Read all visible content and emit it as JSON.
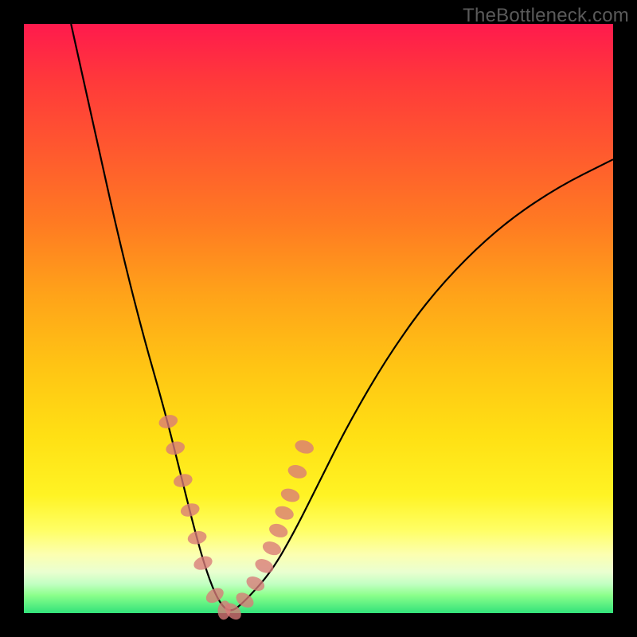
{
  "watermark": "TheBottleneck.com",
  "chart_data": {
    "type": "line",
    "title": "",
    "xlabel": "",
    "ylabel": "",
    "xlim": [
      0,
      100
    ],
    "ylim": [
      0,
      100
    ],
    "grid": false,
    "legend": false,
    "series": [
      {
        "name": "bottleneck-curve",
        "x": [
          8,
          12,
          16,
          20,
          24,
          27,
          29,
          31,
          33,
          35,
          37.5,
          42,
          46,
          50,
          55,
          62,
          70,
          80,
          90,
          100
        ],
        "y": [
          100,
          82,
          64,
          48,
          34,
          22,
          14,
          7,
          2,
          0,
          2,
          7,
          14,
          22,
          32,
          44,
          55,
          65,
          72,
          77
        ]
      }
    ],
    "markers": {
      "name": "highlight-points",
      "color": "#d97a78",
      "x": [
        24.5,
        25.7,
        27.0,
        28.2,
        29.4,
        30.4,
        32.4,
        34.0,
        35.5,
        37.5,
        39.3,
        40.8,
        42.1,
        43.2,
        44.2,
        45.2,
        46.4,
        47.6
      ],
      "y": [
        32.5,
        28.0,
        22.5,
        17.5,
        12.8,
        8.5,
        3.0,
        0.5,
        0.3,
        2.2,
        5.0,
        8.0,
        11.0,
        14.0,
        17.0,
        20.0,
        24.0,
        28.2
      ]
    },
    "background_gradient_note": "vertical red-to-yellow-to-green heat gradient",
    "colors": {
      "curve": "#000000",
      "marker": "#d97a78",
      "frame": "#000000"
    }
  }
}
